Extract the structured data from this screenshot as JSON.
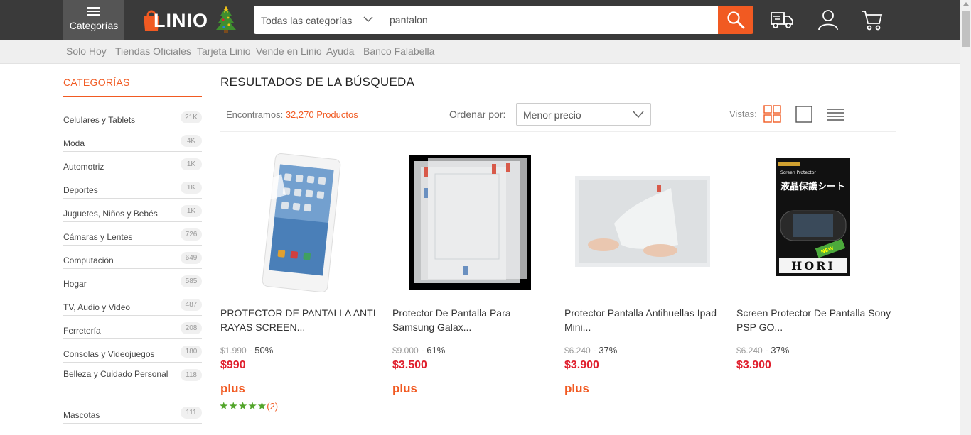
{
  "header": {
    "menu_label": "Categorías",
    "logo_text": "LINIO",
    "category_select": "Todas las categorías",
    "search_value": "pantalon"
  },
  "subnav": [
    "Solo Hoy",
    "Tiendas Oficiales",
    "Tarjeta Linio",
    "Vende en Linio",
    "Ayuda",
    "Banco Falabella"
  ],
  "sidebar": {
    "title": "CATEGORÍAS",
    "items": [
      {
        "label": "Celulares y Tablets",
        "count": "21K"
      },
      {
        "label": "Moda",
        "count": "4K"
      },
      {
        "label": "Automotriz",
        "count": "1K"
      },
      {
        "label": "Deportes",
        "count": "1K"
      },
      {
        "label": "Juguetes, Niños y Bebés",
        "count": "1K"
      },
      {
        "label": "Cámaras y Lentes",
        "count": "726"
      },
      {
        "label": "Computación",
        "count": "649"
      },
      {
        "label": "Hogar",
        "count": "585"
      },
      {
        "label": "TV, Audio y Video",
        "count": "487"
      },
      {
        "label": "Ferretería",
        "count": "208"
      },
      {
        "label": "Consolas y Videojuegos",
        "count": "180"
      },
      {
        "label": "Belleza y Cuidado Personal",
        "count": "118"
      },
      {
        "label": "Mascotas",
        "count": "111"
      }
    ]
  },
  "results": {
    "title": "RESULTADOS DE LA BÚSQUEDA",
    "found_prefix": "Encontramos:",
    "found_count": "32,270 Productos",
    "order_label": "Ordenar por:",
    "order_value": "Menor precio",
    "views_label": "Vistas:"
  },
  "products": [
    {
      "name": "PROTECTOR DE PANTALLA ANTI RAYAS SCREEN...",
      "old_price": "$1.990",
      "discount": " - 50%",
      "price": "$990",
      "plus": "plus",
      "stars": "★★★★★",
      "reviews": "(2)"
    },
    {
      "name": "Protector De Pantalla Para Samsung Galax...",
      "old_price": "$9.000",
      "discount": " - 61%",
      "price": "$3.500",
      "plus": "plus"
    },
    {
      "name": "Protector Pantalla Antihuellas Ipad Mini...",
      "old_price": "$6.240",
      "discount": " - 37%",
      "price": "$3.900",
      "plus": "plus"
    },
    {
      "name": "Screen Protector De Pantalla Sony PSP GO...",
      "old_price": "$6.240",
      "discount": " - 37%",
      "price": "$3.900"
    }
  ],
  "product_images": {
    "psp_pack_top": "Screen Protector",
    "psp_pack_title": "液晶保護シート",
    "psp_pack_brand": "HORI",
    "psp_pack_badge": "NEW"
  },
  "colors": {
    "accent": "#f15a22",
    "price": "#e0202e",
    "header": "#3a3a3a",
    "stars": "#52a52a"
  }
}
